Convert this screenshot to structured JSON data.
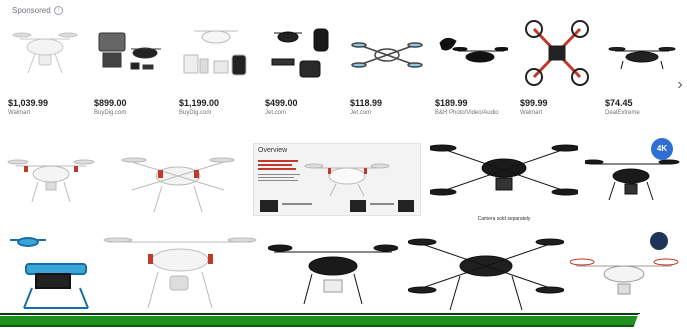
{
  "sponsored": {
    "label": "Sponsored",
    "icon": "info-icon"
  },
  "products": [
    {
      "price": "$1,039.99",
      "store": "Walmart",
      "color": "#ffffff"
    },
    {
      "price": "$899.00",
      "store": "BuyDig.com",
      "color": "#333333"
    },
    {
      "price": "$1,199.00",
      "store": "BuyDig.com",
      "color": "#ffffff"
    },
    {
      "price": "$499.00",
      "store": "Jet.com",
      "color": "#222222"
    },
    {
      "price": "$118.99",
      "store": "Jet.com",
      "color": "#ffffff"
    },
    {
      "price": "$189.99",
      "store": "B&H Photo/Video/Audio",
      "color": "#111111"
    },
    {
      "price": "$99.99",
      "store": "Walmart",
      "color": "#c0392b"
    },
    {
      "price": "$74.45",
      "store": "DealExtreme",
      "color": "#111111"
    }
  ],
  "next_arrow": "›",
  "overview": {
    "title": "Overview"
  },
  "caption_camera": "Camera sold separately",
  "badge_4k": "4K",
  "accent_green": "#1f8f1f"
}
